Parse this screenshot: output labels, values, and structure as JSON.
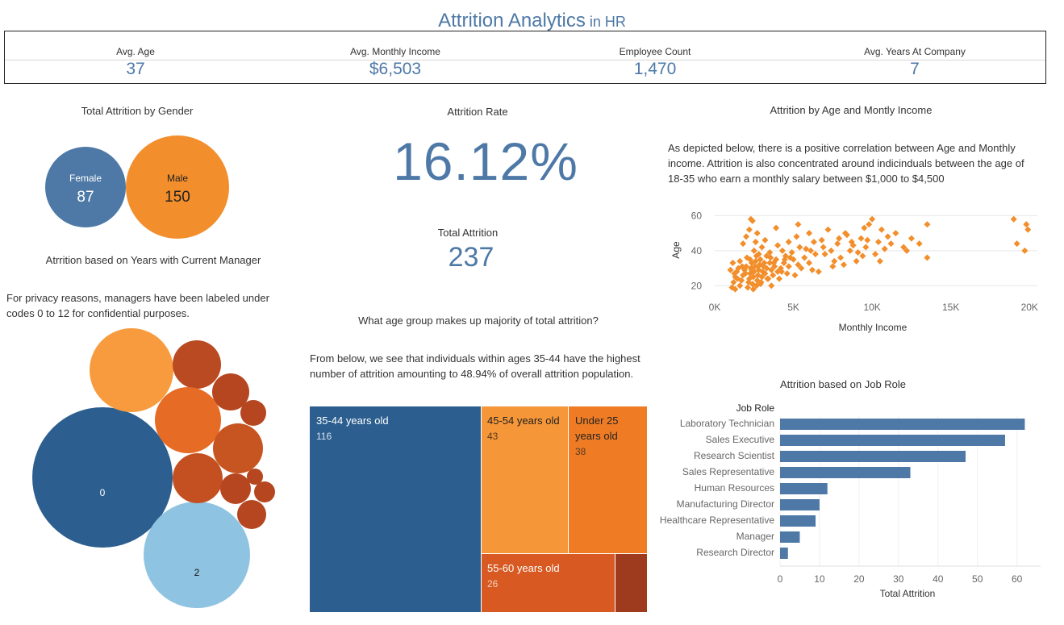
{
  "title": {
    "main": "Attrition Analytics",
    "sub": " in HR"
  },
  "kpis": [
    {
      "label": "Avg. Age",
      "value": "37"
    },
    {
      "label": "Avg. Monthly Income",
      "value": "$6,503"
    },
    {
      "label": "Employee Count",
      "value": "1,470"
    },
    {
      "label": "Avg. Years At Company",
      "value": "7"
    }
  ],
  "gender": {
    "title": "Total Attrition by Gender",
    "items": [
      {
        "label": "Female",
        "value": 87,
        "color": "#4e79a7"
      },
      {
        "label": "Male",
        "value": 150,
        "color": "#f28e2b"
      }
    ]
  },
  "rate": {
    "title": "Attrition Rate",
    "value": "16.12%",
    "total_title": "Total Attrition",
    "total_value": "237"
  },
  "manager": {
    "title": "Atrrition based on Years with Current Manager",
    "note": "For privacy reasons, managers have been labeled under codes 0 to 12 for confidential purposes."
  },
  "agegroup": {
    "title": "What age group makes up majority of total attrition?",
    "note": "From below, we see that individuals within ages 35-44 have the highest number of attrition amounting to 48.94% of overall attrition population."
  },
  "scatter_meta": {
    "title": "Attrition by Age and Montly Income",
    "note": "As depicted below, there is a positive correlation between Age and Monthly income. Attrition is also concentrated around indicinduals between the age of 18-35 who earn a monthly salary between $1,000 to $4,500"
  },
  "jobrole_meta": {
    "title": "Attrition based on Job Role"
  },
  "chart_data": [
    {
      "type": "pie",
      "name": "gender-bubbles",
      "categories": [
        "Female",
        "Male"
      ],
      "values": [
        87,
        150
      ]
    },
    {
      "type": "scatter",
      "name": "age-income-scatter",
      "xlabel": "Monthly Income",
      "ylabel": "Age",
      "xlim": [
        0,
        20500
      ],
      "ylim": [
        16,
        62
      ],
      "xticks": [
        "0K",
        "5K",
        "10K",
        "15K",
        "20K"
      ],
      "yticks": [
        "20",
        "40",
        "60"
      ],
      "grid": true,
      "color": "#f28e2b",
      "points": [
        [
          1100,
          19
        ],
        [
          1200,
          22
        ],
        [
          1300,
          25
        ],
        [
          1400,
          28
        ],
        [
          1500,
          30
        ],
        [
          1600,
          20
        ],
        [
          1700,
          23
        ],
        [
          1800,
          26
        ],
        [
          1900,
          29
        ],
        [
          2000,
          31
        ],
        [
          2100,
          19
        ],
        [
          2150,
          22
        ],
        [
          2200,
          24
        ],
        [
          2250,
          27
        ],
        [
          2300,
          30
        ],
        [
          2350,
          33
        ],
        [
          2400,
          21
        ],
        [
          2450,
          25
        ],
        [
          2500,
          28
        ],
        [
          2550,
          31
        ],
        [
          2600,
          34
        ],
        [
          2650,
          20
        ],
        [
          2700,
          23
        ],
        [
          2750,
          26
        ],
        [
          2800,
          29
        ],
        [
          2850,
          32
        ],
        [
          2900,
          35
        ],
        [
          2950,
          22
        ],
        [
          3000,
          25
        ],
        [
          3050,
          28
        ],
        [
          3100,
          31
        ],
        [
          3200,
          27
        ],
        [
          3300,
          30
        ],
        [
          3400,
          24
        ],
        [
          3500,
          33
        ],
        [
          3600,
          29
        ],
        [
          3700,
          26
        ],
        [
          3800,
          31
        ],
        [
          3900,
          35
        ],
        [
          4000,
          28
        ],
        [
          4200,
          30
        ],
        [
          4400,
          33
        ],
        [
          4600,
          27
        ],
        [
          4800,
          36
        ],
        [
          1800,
          44
        ],
        [
          2000,
          48
        ],
        [
          2200,
          52
        ],
        [
          2300,
          58
        ],
        [
          2400,
          57
        ],
        [
          2500,
          40
        ],
        [
          2600,
          45
        ],
        [
          2700,
          50
        ],
        [
          2800,
          38
        ],
        [
          3000,
          42
        ],
        [
          3200,
          46
        ],
        [
          3500,
          39
        ],
        [
          4000,
          43
        ],
        [
          4500,
          37
        ],
        [
          5000,
          35
        ],
        [
          5200,
          48
        ],
        [
          5500,
          30
        ],
        [
          5800,
          41
        ],
        [
          6000,
          33
        ],
        [
          6300,
          45
        ],
        [
          6600,
          28
        ],
        [
          7000,
          38
        ],
        [
          7200,
          52
        ],
        [
          7500,
          31
        ],
        [
          7800,
          44
        ],
        [
          8000,
          36
        ],
        [
          8300,
          50
        ],
        [
          8600,
          40
        ],
        [
          9000,
          34
        ],
        [
          9300,
          47
        ],
        [
          9600,
          42
        ],
        [
          9800,
          55
        ],
        [
          10000,
          58
        ],
        [
          10200,
          38
        ],
        [
          10400,
          45
        ],
        [
          10600,
          52
        ],
        [
          11000,
          48
        ],
        [
          11500,
          50
        ],
        [
          12000,
          42
        ],
        [
          12500,
          47
        ],
        [
          13000,
          44
        ],
        [
          13500,
          55
        ],
        [
          13500,
          36
        ],
        [
          19000,
          58
        ],
        [
          19200,
          44
        ],
        [
          19700,
          40
        ],
        [
          19800,
          55
        ],
        [
          19900,
          52
        ],
        [
          1000,
          29
        ],
        [
          1300,
          18
        ],
        [
          1600,
          34
        ],
        [
          2050,
          36
        ],
        [
          2450,
          18
        ],
        [
          2900,
          21
        ],
        [
          3300,
          37
        ],
        [
          3600,
          20
        ],
        [
          4100,
          24
        ],
        [
          4300,
          40
        ],
        [
          4700,
          31
        ],
        [
          5100,
          26
        ],
        [
          5400,
          42
        ],
        [
          5700,
          36
        ],
        [
          6200,
          29
        ],
        [
          6800,
          46
        ],
        [
          7400,
          40
        ],
        [
          8200,
          32
        ],
        [
          8800,
          43
        ],
        [
          9400,
          37
        ],
        [
          10800,
          41
        ],
        [
          11200,
          44
        ],
        [
          1150,
          33
        ],
        [
          1250,
          27
        ],
        [
          1750,
          31
        ],
        [
          2250,
          35
        ],
        [
          2650,
          37
        ],
        [
          3350,
          24
        ],
        [
          3750,
          33
        ],
        [
          4250,
          28
        ],
        [
          4900,
          39
        ],
        [
          6400,
          38
        ],
        [
          7600,
          34
        ],
        [
          9100,
          39
        ],
        [
          1450,
          24
        ],
        [
          1950,
          27
        ],
        [
          2350,
          29
        ],
        [
          2750,
          31
        ],
        [
          3150,
          33
        ],
        [
          3550,
          36
        ],
        [
          4450,
          35
        ],
        [
          5300,
          32
        ],
        [
          6100,
          40
        ],
        [
          6900,
          42
        ],
        [
          7900,
          47
        ],
        [
          8700,
          45
        ],
        [
          9700,
          46
        ],
        [
          10500,
          34
        ],
        [
          12200,
          40
        ],
        [
          3900,
          53
        ],
        [
          4700,
          45
        ],
        [
          5300,
          55
        ],
        [
          6000,
          50
        ],
        [
          8400,
          49
        ],
        [
          9500,
          53
        ]
      ]
    },
    {
      "type": "bar",
      "name": "job-role-bars",
      "orientation": "horizontal",
      "header": "Job Role",
      "categories": [
        "Laboratory Technician",
        "Sales Executive",
        "Research Scientist",
        "Sales Representative",
        "Human Resources",
        "Manufacturing Director",
        "Healthcare Representative",
        "Manager",
        "Research Director"
      ],
      "values": [
        62,
        57,
        47,
        33,
        12,
        10,
        9,
        5,
        2
      ],
      "xlabel": "Total Attrition",
      "xlim": [
        0,
        66
      ],
      "xticks": [
        0,
        10,
        20,
        30,
        40,
        50,
        60
      ],
      "color": "#4e79a7"
    },
    {
      "type": "heatmap",
      "subtype": "treemap",
      "name": "age-group-treemap",
      "categories": [
        "35-44 years old",
        "45-54 years old",
        "Under 25 years old",
        "55-60 years old",
        ""
      ],
      "values": [
        116,
        43,
        38,
        26,
        14
      ],
      "labels": [
        "116",
        "43",
        "38",
        "26",
        ""
      ],
      "colors": [
        "#2c5f8f",
        "#f59638",
        "#ef7c24",
        "#d85a22",
        "#9e3b1f"
      ]
    },
    {
      "type": "scatter",
      "subtype": "packed-bubbles",
      "name": "manager-years-bubbles",
      "labels": [
        "0",
        "2",
        "",
        "",
        "",
        "",
        "",
        "",
        "",
        "",
        "",
        "",
        ""
      ],
      "colors": [
        "#2c5f8f",
        "#8ec4e2",
        "#f79b3e",
        "#b94a22",
        "#b5461f",
        "#e66b25",
        "#c75522",
        "#c45022",
        "#b5461f",
        "#b5461f",
        "#b5461f",
        "#b5461f",
        "#b5461f"
      ]
    }
  ]
}
